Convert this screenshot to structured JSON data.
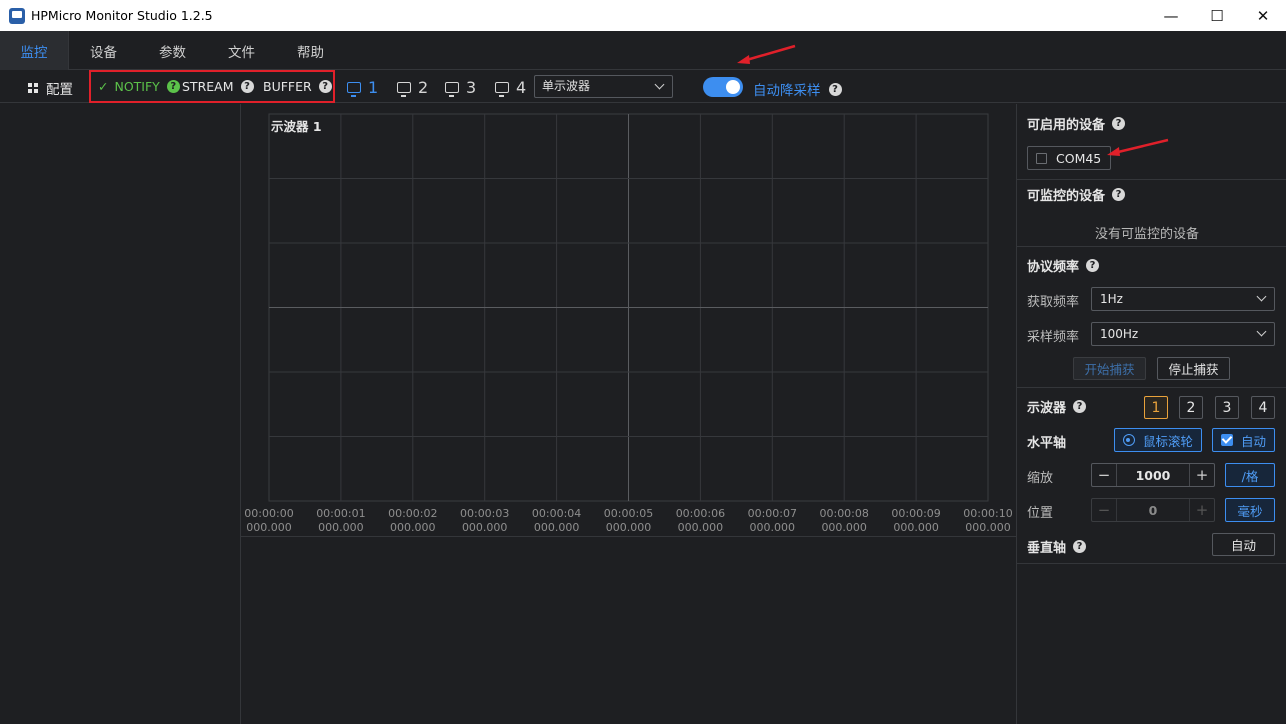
{
  "window": {
    "title": "HPMicro Monitor Studio 1.2.5",
    "min": "—",
    "max": "☐",
    "close": "✕"
  },
  "menu": [
    {
      "label": "监控",
      "active": true
    },
    {
      "label": "设备",
      "active": false
    },
    {
      "label": "参数",
      "active": false
    },
    {
      "label": "文件",
      "active": false
    },
    {
      "label": "帮助",
      "active": false
    }
  ],
  "toolbar": {
    "config_label": "配置",
    "modes": {
      "notify": "NOTIFY",
      "stream": "STREAM",
      "buffer": "BUFFER"
    },
    "scopes": [
      "1",
      "2",
      "3",
      "4"
    ],
    "scope_select": "单示波器",
    "auto_downsample_label": "自动降采样",
    "auto_downsample_on": true
  },
  "chart_data": {
    "type": "line",
    "title": "示波器 1",
    "series": [],
    "x_ticks": [
      [
        "00:00:00",
        "000.000"
      ],
      [
        "00:00:01",
        "000.000"
      ],
      [
        "00:00:02",
        "000.000"
      ],
      [
        "00:00:03",
        "000.000"
      ],
      [
        "00:00:04",
        "000.000"
      ],
      [
        "00:00:05",
        "000.000"
      ],
      [
        "00:00:06",
        "000.000"
      ],
      [
        "00:00:07",
        "000.000"
      ],
      [
        "00:00:08",
        "000.000"
      ],
      [
        "00:00:09",
        "000.000"
      ],
      [
        "00:00:10",
        "000.000"
      ]
    ],
    "grid": true
  },
  "right": {
    "available_title": "可启用的设备",
    "com_port": "COM45",
    "monitorable_title": "可监控的设备",
    "no_device": "没有可监控的设备",
    "protocol_title": "协议频率",
    "fetch_label": "获取频率",
    "fetch_value": "1Hz",
    "sample_label": "采样频率",
    "sample_value": "100Hz",
    "start_capture": "开始捕获",
    "stop_capture": "停止捕获",
    "scope_title": "示波器",
    "scope_nums": [
      "1",
      "2",
      "3",
      "4"
    ],
    "h_axis_title": "水平轴",
    "mouse_wheel": "鼠标滚轮",
    "auto": "自动",
    "zoom_label": "缩放",
    "zoom_value": "1000",
    "zoom_unit": "/格",
    "pos_label": "位置",
    "pos_value": "0",
    "pos_unit": "毫秒",
    "v_axis_title": "垂直轴",
    "v_auto": "自动"
  },
  "colors": {
    "accent": "#3d8ef0",
    "highlight": "#e0202a",
    "active_scope": "#e9a23b",
    "ok": "#5cc24a"
  }
}
